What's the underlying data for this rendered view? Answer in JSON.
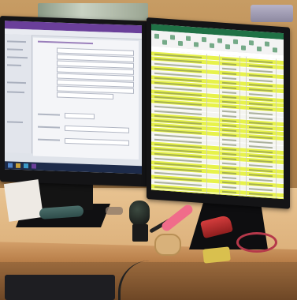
{
  "scene": {
    "description_tags": [
      "left-monitor-form-app",
      "right-monitor-spreadsheet"
    ],
    "colors": {
      "wall": "#c79c64",
      "desk": "#e8c391",
      "monitor_frame": "#141416",
      "spreadsheet_highlight": "#e7f24a",
      "app_titlebar": "#6a3f9a",
      "excel_titlebar": "#1f7145"
    },
    "icons": [
      "monitor-left",
      "monitor-right",
      "stamp",
      "tape-dispenser",
      "highlighter",
      "stapler"
    ]
  },
  "spreadsheet": {
    "highlighted_rows": 18,
    "plain_rows": 12
  }
}
